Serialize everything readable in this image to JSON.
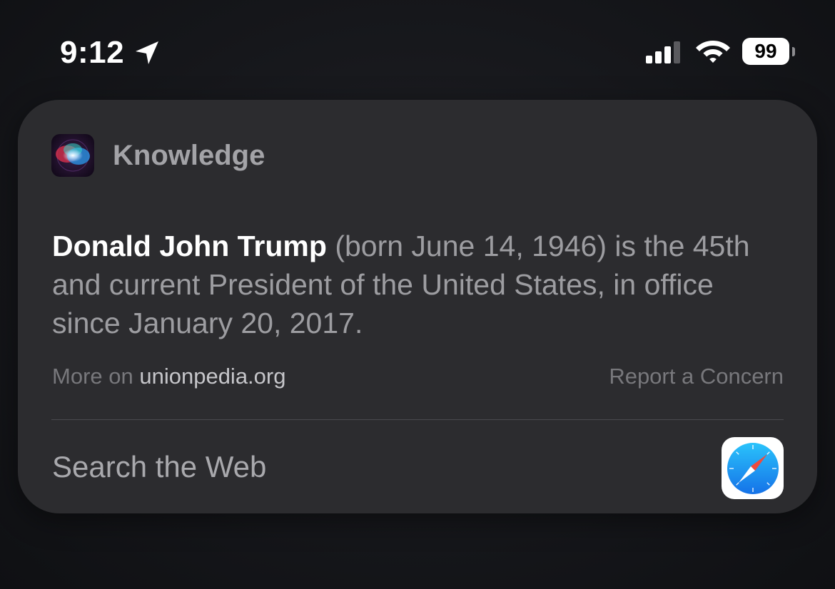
{
  "status_bar": {
    "time": "9:12",
    "battery_level": "99",
    "icons": [
      "location-arrow-icon",
      "cellular-signal-icon",
      "wifi-icon",
      "battery-icon"
    ]
  },
  "card": {
    "app_icon": "siri-icon",
    "title": "Knowledge",
    "summary": {
      "subject": "Donald John Trump",
      "text": " (born June 14, 1946) is the 45th and current President of the United States, in office since January 20, 2017."
    },
    "source": {
      "prefix": "More on",
      "site": "unionpedia.org"
    },
    "report_label": "Report a Concern",
    "search_web_label": "Search the Web",
    "search_icon": "safari-icon"
  },
  "colors": {
    "background": "#16171b",
    "card": "#2c2c2f",
    "title_gray": "#a3a3a7",
    "text_gray": "#9d9da1",
    "safari_blue": "#1a8ef0",
    "safari_red": "#f04a3c"
  }
}
